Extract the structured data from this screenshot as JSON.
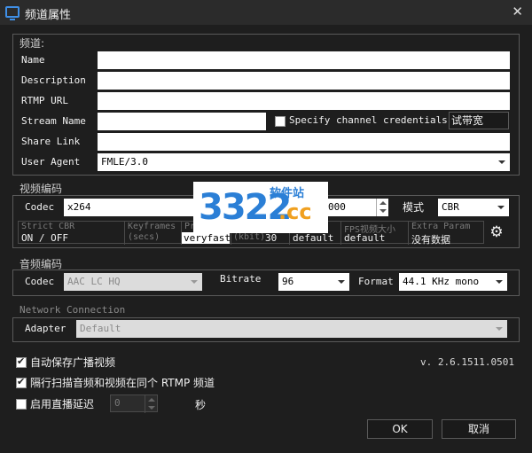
{
  "window": {
    "title": "频道属性"
  },
  "channel": {
    "section_label": "频道:",
    "rows": [
      {
        "label": "Name",
        "value": ""
      },
      {
        "label": "Description",
        "value": ""
      },
      {
        "label": "RTMP URL",
        "value": ""
      },
      {
        "label": "Stream Name",
        "value": ""
      },
      {
        "label": "Share Link",
        "value": ""
      },
      {
        "label": "User Agent",
        "value": "FMLE/3.0"
      }
    ],
    "specify_credentials_label": "Specify channel credentials",
    "speed_test_label": "试带宽"
  },
  "video": {
    "section_label": "视频编码",
    "codec_label": "Codec",
    "codec_value": "x264",
    "bitrate_value": "000",
    "mode_label": "模式",
    "mode_value": "CBR",
    "grid": [
      {
        "header": "Strict CBR",
        "value": "ON / OFF"
      },
      {
        "header": "Keyframes",
        "value": ""
      },
      {
        "header": "Pr",
        "value": "veryfast"
      },
      {
        "header": "(kbit)",
        "value": "30"
      },
      {
        "header": "",
        "value": "default"
      },
      {
        "header": "FPS视频大小",
        "value": "default"
      },
      {
        "header": "Extra Param",
        "value": "没有数据"
      }
    ],
    "grid_sub_header": "(secs)"
  },
  "audio": {
    "section_label": "音频编码",
    "codec_label": "Codec",
    "codec_value": "AAC LC HQ",
    "bitrate_label": "Bitrate",
    "bitrate_value": "96",
    "format_label": "Format",
    "format_value": "44.1 KHz mono"
  },
  "network": {
    "section_label": "Network Connection",
    "adapter_label": "Adapter",
    "adapter_value": "Default"
  },
  "options": {
    "auto_save_label": "自动保存广播视频",
    "auto_save_checked": true,
    "interlace_label": "隔行扫描音频和视频在同个 RTMP 频道",
    "interlace_checked": true,
    "delay_label": "启用直播延迟",
    "delay_checked": false,
    "delay_value": "0",
    "delay_unit": "秒"
  },
  "version": "v. 2.6.1511.0501",
  "buttons": {
    "ok": "OK",
    "cancel": "取消"
  },
  "watermark": {
    "brand_number": "3322",
    "brand_text": "软件站",
    "brand_tld": ".cc"
  }
}
